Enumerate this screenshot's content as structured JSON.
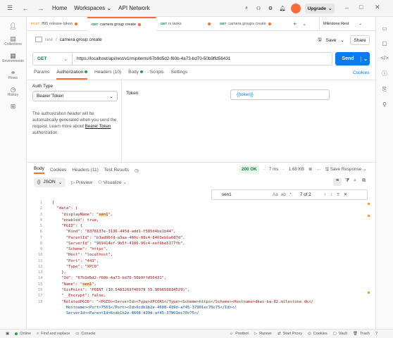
{
  "topbar": {
    "home_label": "Home",
    "workspaces_label": "Workspaces",
    "api_network_label": "API Network",
    "upgrade_label": "Upgrade"
  },
  "sidebar": {
    "items": [
      {
        "label": "Collections",
        "icon": "collections-icon"
      },
      {
        "label": "Environments",
        "icon": "environments-icon"
      },
      {
        "label": "Flows",
        "icon": "flows-icon"
      },
      {
        "label": "History",
        "icon": "history-icon"
      }
    ]
  },
  "tabs": [
    {
      "method": "POST",
      "label": "ff95 release token",
      "method_color": "#e6a23c",
      "dot": "#ff6c37"
    },
    {
      "method": "GET",
      "label": "camera group create",
      "method_color": "#0f7b3e",
      "dot": "#ff6c37",
      "active": true
    },
    {
      "method": "GET",
      "label": "rs tasks",
      "method_color": "#0f7b3e",
      "dot": "#ff6c37"
    },
    {
      "method": "GET",
      "label": "camera groups create",
      "method_color": "#0f7b3e",
      "dot": "#ff6c37"
    }
  ],
  "environment": {
    "label": "Milestone Rest"
  },
  "breadcrumb": {
    "parent": "rest",
    "current": "camera group create"
  },
  "actions": {
    "save_label": "Save",
    "share_label": "Share"
  },
  "request": {
    "method": "GET",
    "url": "https://localhost/api/rest/v1/mipitems/67b9d5d2-f60b-4a73-bd70-50b9ffd56431",
    "send_label": "Send"
  },
  "request_tabs": {
    "params": "Params",
    "authorization": "Authorization",
    "headers": "Headers (10)",
    "body": "Body",
    "scripts": "Scripts",
    "settings": "Settings",
    "cookies": "Cookies"
  },
  "auth": {
    "type_label": "Auth Type",
    "type_value": "Bearer Token",
    "description_1": "The authorization header will be automatically generated when you send the request. Learn more about",
    "description_link": "Bearer Token",
    "description_2": "authorization.",
    "token_label": "Token",
    "token_value": "{{token}}"
  },
  "response": {
    "tabs": {
      "body": "Body",
      "cookies": "Cookies",
      "headers": "Headers (11)",
      "test_results": "Test Results"
    },
    "status": "200 OK",
    "time": "7 ms",
    "size": "1.68 KB",
    "save_label": "Save Response",
    "format": "JSON",
    "preview_label": "Preview",
    "visualize_label": "Visualize"
  },
  "find": {
    "query": "sen1",
    "opt_case": "Aa",
    "opt_word": "ab",
    "opt_regex": ".*",
    "count": "7 of 2"
  },
  "code_lines": [
    {
      "n": "1",
      "text": "["
    },
    {
      "n": "2",
      "text": "  \"data\": ["
    },
    {
      "n": "3",
      "text": "    \"displayName\": \"sen1\","
    },
    {
      "n": "4",
      "text": "    \"enabled\": true,"
    },
    {
      "n": "5",
      "text": "    \"PGID\": {"
    },
    {
      "n": "6",
      "text": "      \"Kind\": \"8378137e-3136-445d-add1-f585d4be1b44\","
    },
    {
      "n": "7",
      "text": "      \"ParentId\": \"b3ad96fd-a3aa-460c-88c4-8403ebba687d\","
    },
    {
      "n": "8",
      "text": "      \"ServerId\": \"969414ef-9b5f-4186-96c4-eef9be5177fb\","
    },
    {
      "n": "9",
      "text": "      \"Scheme\": \"https\","
    },
    {
      "n": "10",
      "text": "      \"Host\": \"localhost\","
    },
    {
      "n": "11",
      "text": "      \"Port\": \"443\","
    },
    {
      "n": "12",
      "text": "      \"Type\": \"XPCO\""
    },
    {
      "n": "13",
      "text": "    },"
    },
    {
      "n": "14",
      "text": "    \"Id\": \"67b9d5d2-f60b-4a73-bd70-50b9ffd56431\","
    },
    {
      "n": "15",
      "text": "    \"Name\": \"sen1\","
    },
    {
      "n": "16",
      "text": "    \"GisPoint\": \"POINT (10.5483269746979 55.909650834529)\","
    },
    {
      "n": "17",
      "text": "    \"__Encrypt\": false,"
    },
    {
      "n": "18",
      "text": "    \"RelatedPGID\": \"<PGID><ServerId><Type>XPCORS</Type><Scheme>https</Scheme><Hostname>dkws-ba-82.milestone.dk</"
    },
    {
      "n": "",
      "text": "      Hostname><Port>7563</Port><Id>6cdb1b2e-4608-439d-af45-37901ec70c75</Id></"
    },
    {
      "n": "",
      "text": "      ServerId><ParentId>6cdb1b2e-4608-439d-af45-37901ec70c75</"
    }
  ],
  "status_bar": {
    "online": "Online",
    "find_replace": "Find and replace",
    "console": "Console",
    "postbot": "Postbot",
    "runner": "Runner",
    "start_proxy": "Start Proxy",
    "cookies": "Cookies",
    "vault": "Vault",
    "trash": "Trash"
  }
}
